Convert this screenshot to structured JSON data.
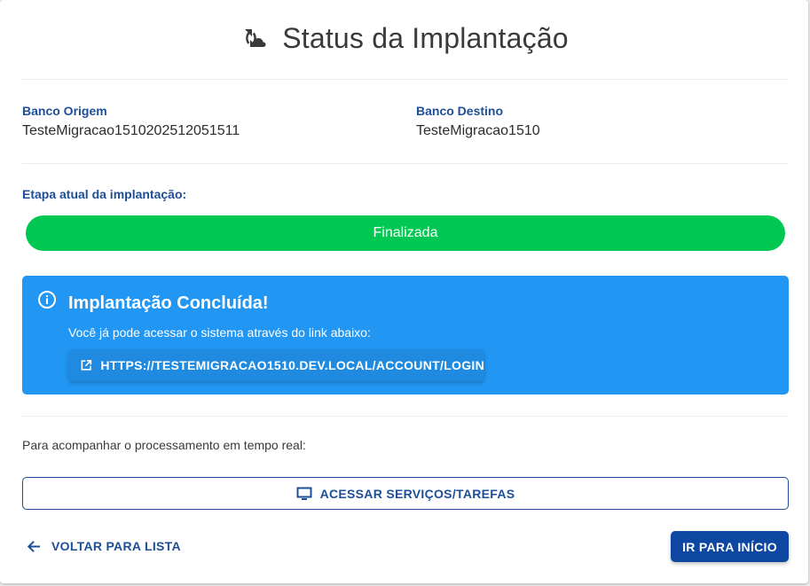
{
  "header": {
    "title": "Status da Implantação",
    "icon": "cloud-sync-icon"
  },
  "origin": {
    "label": "Banco Origem",
    "value": "TesteMigracao1510202512051511"
  },
  "destination": {
    "label": "Banco Destino",
    "value": "TesteMigracao1510"
  },
  "stage": {
    "label": "Etapa atual da implantação:",
    "status": "Finalizada",
    "color": "#00c853"
  },
  "alert": {
    "icon": "info-icon",
    "title": "Implantação Concluída!",
    "message": "Você já pode acessar o sistema através do link abaixo:",
    "link_icon": "external-link-icon",
    "link_label": "HTTPS://TESTEMIGRACAO1510.DEV.LOCAL/ACCOUNT/LOGIN",
    "color": "#2196f3"
  },
  "realtime": {
    "text": "Para acompanhar o processamento em tempo real:",
    "button_icon": "monitor-icon",
    "button_label": "ACESSAR SERVIÇOS/TAREFAS"
  },
  "footer": {
    "back_icon": "arrow-left-icon",
    "back_label": "VOLTAR PARA LISTA",
    "home_label": "IR PARA INÍCIO"
  },
  "colors": {
    "primary": "#0d47a1",
    "label": "#1e4f96"
  }
}
